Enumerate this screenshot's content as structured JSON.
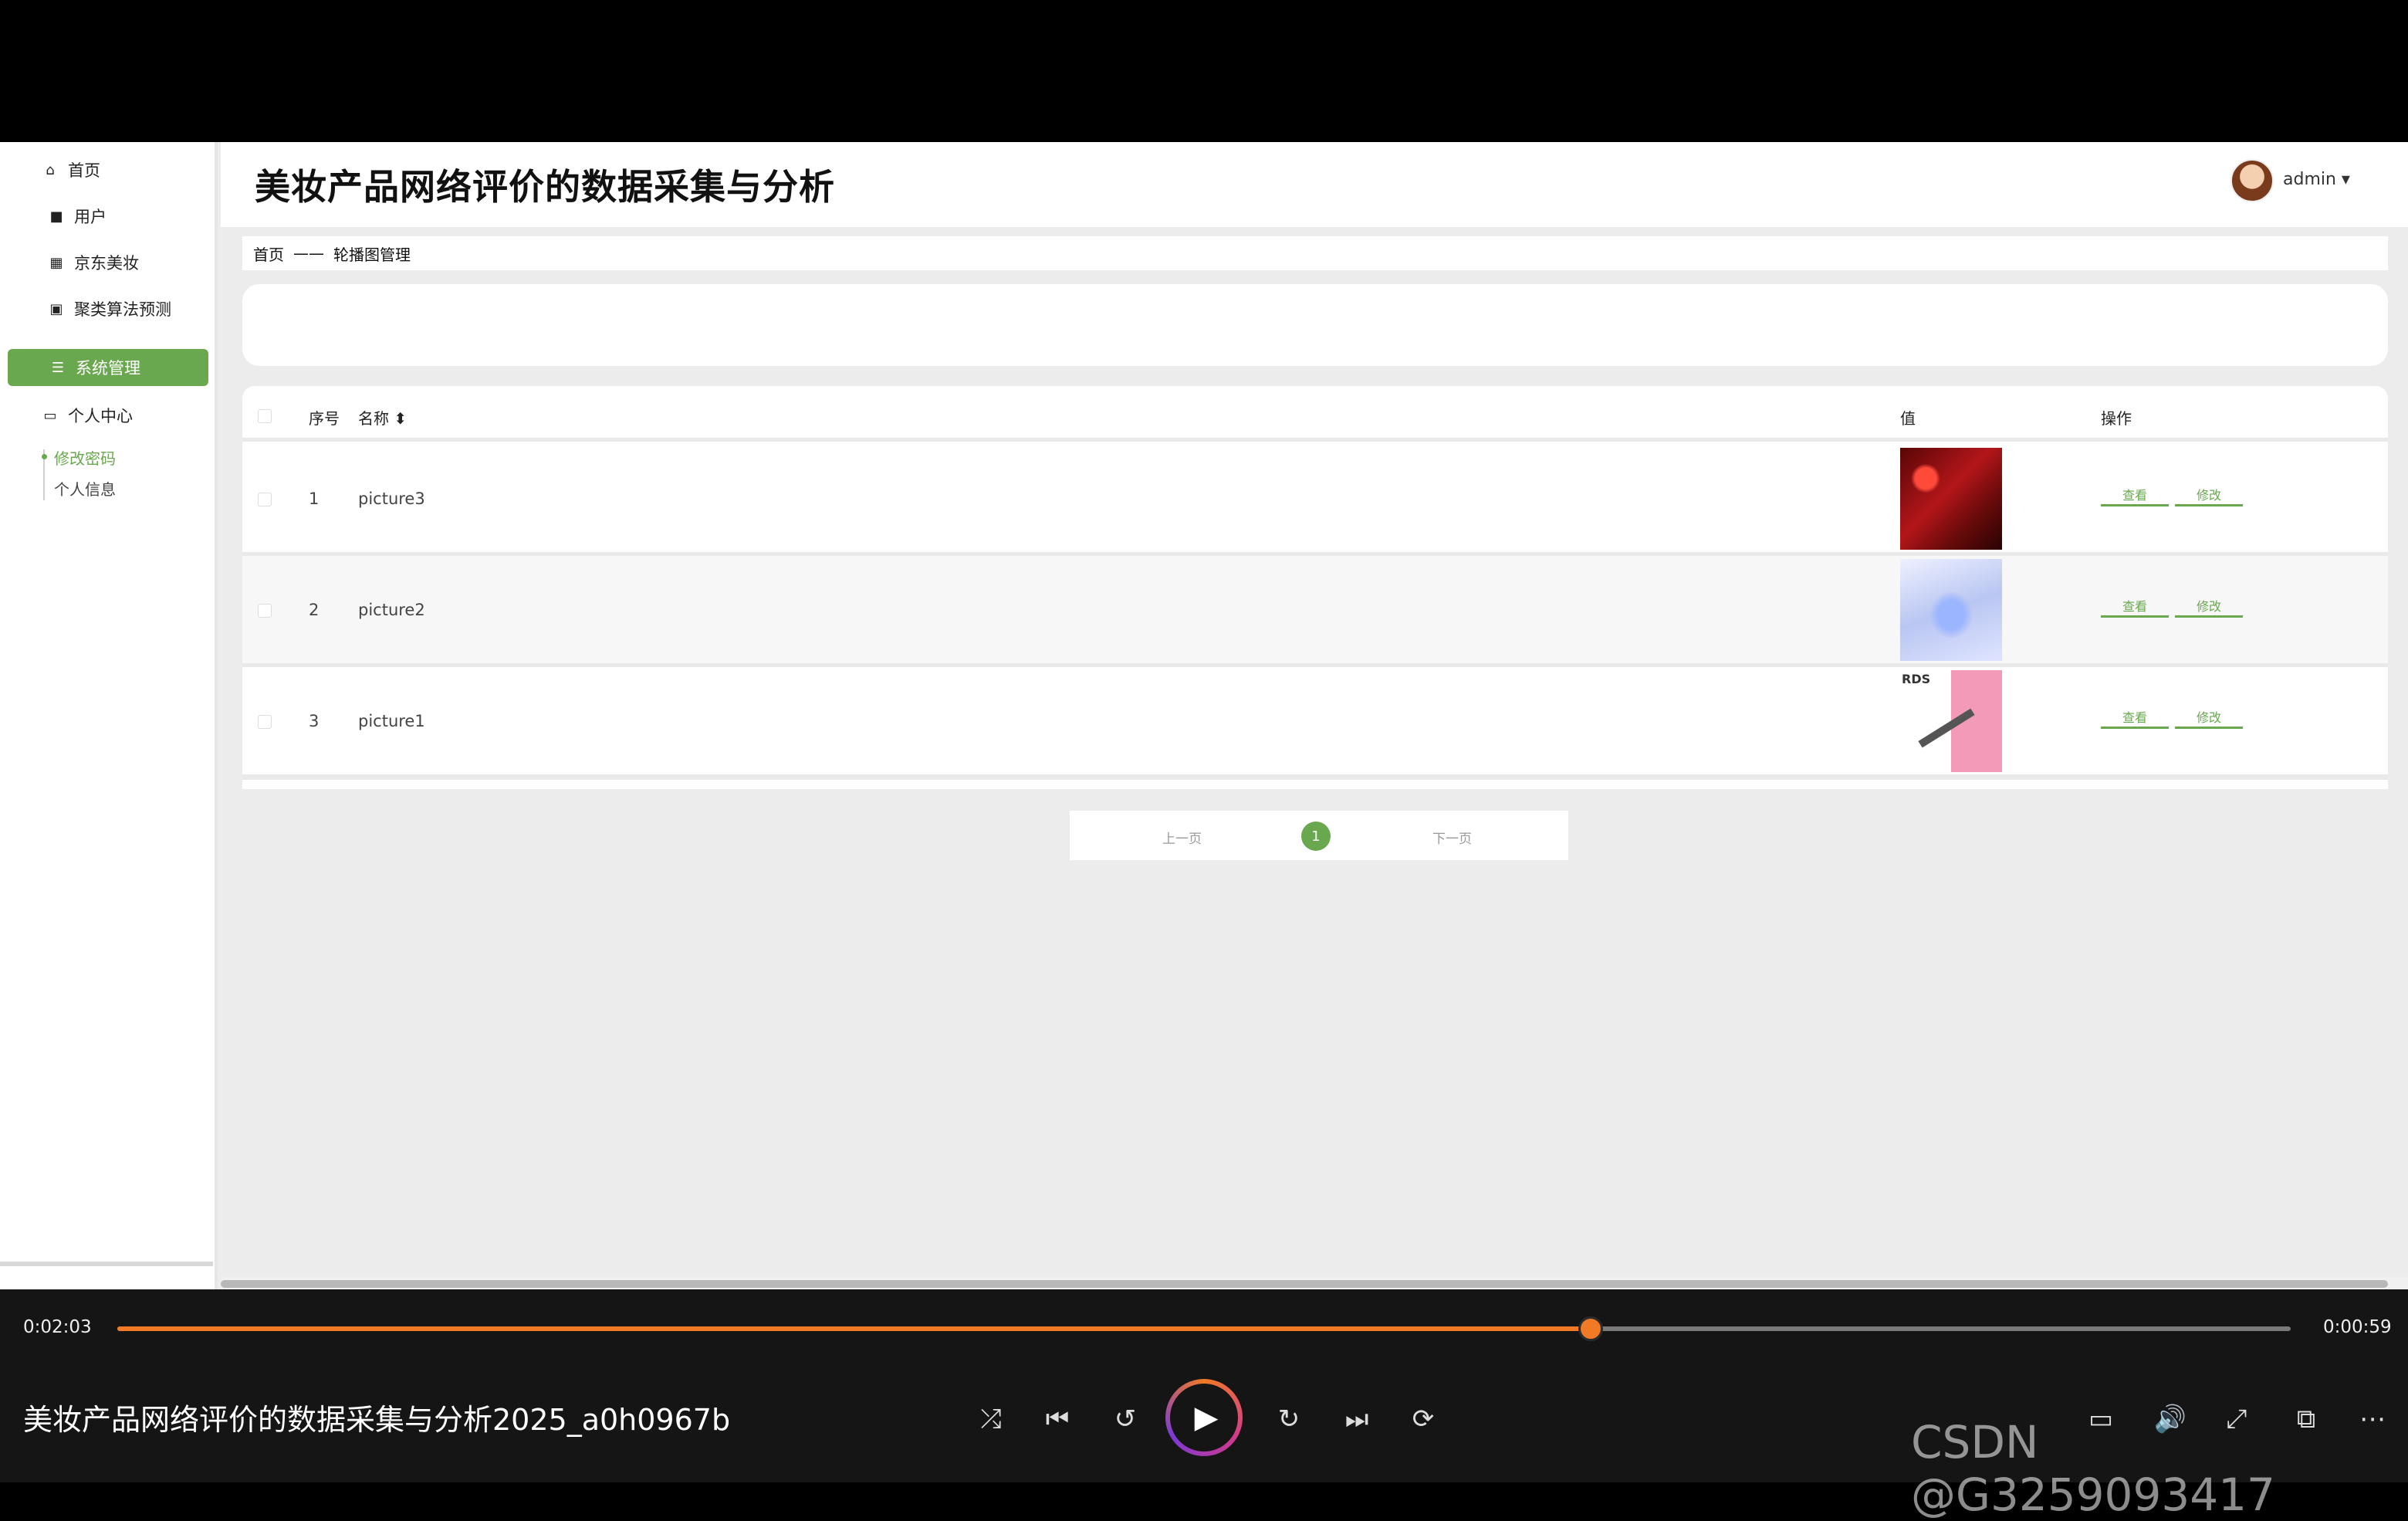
{
  "header": {
    "title": "美妆产品网络评价的数据采集与分析",
    "user": "admin ▾"
  },
  "sidebar": {
    "items": [
      {
        "icon": "⌂",
        "label": "首页"
      },
      {
        "icon": "■",
        "label": "用户"
      },
      {
        "icon": "▦",
        "label": "京东美妆"
      },
      {
        "icon": "▣",
        "label": "聚类算法预测"
      },
      {
        "icon": "☰",
        "label": "系统管理"
      },
      {
        "icon": "▭",
        "label": "个人中心"
      }
    ],
    "subitems": [
      {
        "label": "修改密码"
      },
      {
        "label": "个人信息"
      }
    ]
  },
  "breadcrumb": {
    "home": "首页",
    "sep": "——",
    "current": "轮播图管理"
  },
  "table": {
    "headers": {
      "index": "序号",
      "name": "名称 ⬍",
      "value": "值",
      "action": "操作"
    },
    "rows": [
      {
        "index": "1",
        "name": "picture3",
        "view": "查看",
        "edit": "修改"
      },
      {
        "index": "2",
        "name": "picture2",
        "view": "查看",
        "edit": "修改"
      },
      {
        "index": "3",
        "name": "picture1",
        "thumb_text": "RDS",
        "view": "查看",
        "edit": "修改"
      }
    ]
  },
  "pagination": {
    "prev": "上一页",
    "page": "1",
    "next": "下一页"
  },
  "player": {
    "current_time": "0:02:03",
    "total_time": "0:00:59",
    "progress": 0.678,
    "video_title": "美妆产品网络评价的数据采集与分析2025_a0h0967b",
    "accent": "#f07a26",
    "controls": [
      "shuffle-icon",
      "previous-icon",
      "rewind-10-icon",
      "play-icon",
      "forward-30-icon",
      "next-icon",
      "repeat-off-icon",
      "subtitle-icon",
      "volume-icon",
      "fullscreen-icon",
      "pip-icon",
      "more-icon"
    ],
    "watermark": "CSDN @G3259093417"
  },
  "colors": {
    "accent_green": "#6aa84f"
  }
}
